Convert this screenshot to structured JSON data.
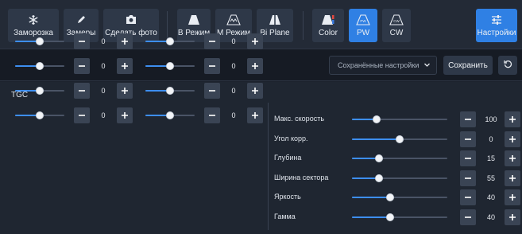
{
  "toolbar": {
    "buttons": [
      {
        "label": "Заморозка",
        "icon": "snowflake-icon",
        "active": false
      },
      {
        "label": "Замеры",
        "icon": "pencil-icon",
        "active": false
      },
      {
        "label": "Сделать фото",
        "icon": "camera-icon",
        "active": false
      },
      {
        "label": "В Режим",
        "icon": "b-mode-icon",
        "active": false
      },
      {
        "label": "M Режим",
        "icon": "m-mode-icon",
        "active": false
      },
      {
        "label": "Bi Plane",
        "icon": "biplane-icon",
        "active": false
      },
      {
        "label": "Color",
        "icon": "color-doppler-icon",
        "active": false
      },
      {
        "label": "PW",
        "icon": "pw-icon",
        "active": true
      },
      {
        "label": "CW",
        "icon": "cw-icon",
        "active": false
      },
      {
        "label": "Настройки",
        "icon": "settings-sliders-icon",
        "active": true
      }
    ]
  },
  "settings_bar": {
    "preset_placeholder": "Сохранённые настройки",
    "save_label": "Сохранить",
    "reset_icon": "reset-icon"
  },
  "tgc": {
    "title": "TGC",
    "rows": [
      {
        "left": {
          "value": "0",
          "level": 0.5
        },
        "right": {
          "value": "0",
          "level": 0.5
        }
      },
      {
        "left": {
          "value": "0",
          "level": 0.5
        },
        "right": {
          "value": "0",
          "level": 0.5
        }
      },
      {
        "left": {
          "value": "0",
          "level": 0.5
        },
        "right": {
          "value": "0",
          "level": 0.5
        }
      },
      {
        "left": {
          "value": "0",
          "level": 0.5
        },
        "right": {
          "value": "0",
          "level": 0.5
        }
      }
    ]
  },
  "params": [
    {
      "label": "Макс. скорость",
      "value": "100",
      "level": 0.26
    },
    {
      "label": "Угол корр.",
      "value": "0",
      "level": 0.5
    },
    {
      "label": "Глубина",
      "value": "15",
      "level": 0.28
    },
    {
      "label": "Ширина сектора",
      "value": "55",
      "level": 0.28
    },
    {
      "label": "Яркость",
      "value": "40",
      "level": 0.4
    },
    {
      "label": "Гамма",
      "value": "40",
      "level": 0.4
    }
  ],
  "colors": {
    "accent": "#2f80e4",
    "slider_fill": "#3d8ef0",
    "background": "#1c222d"
  }
}
